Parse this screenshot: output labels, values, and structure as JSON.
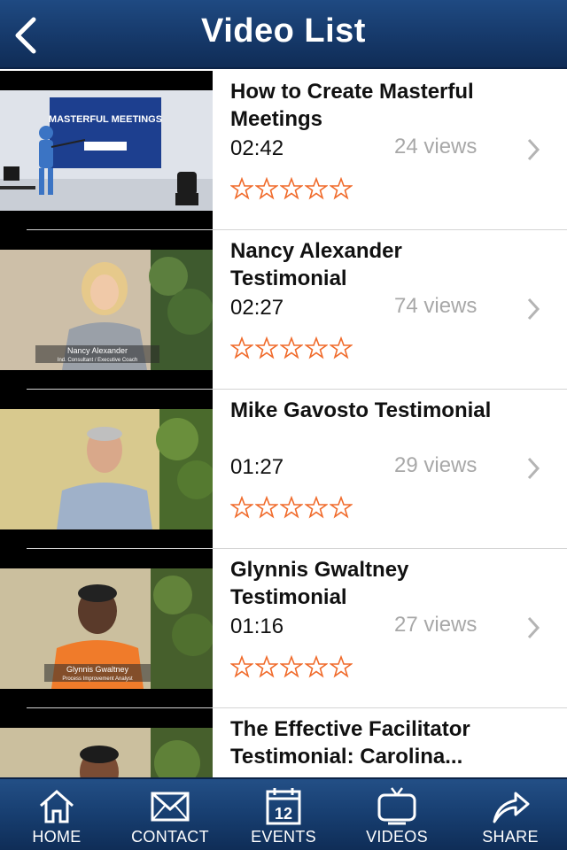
{
  "header": {
    "title": "Video List",
    "back_icon": "chevron-left-icon"
  },
  "videos": [
    {
      "title": "How to Create Masterful Meetings",
      "duration": "02:42",
      "views": "24 views",
      "rating": 0,
      "thumb_caption": "MASTERFUL MEETINGS",
      "thumb_subcaption": ""
    },
    {
      "title": "Nancy Alexander Testimonial",
      "duration": "02:27",
      "views": "74 views",
      "rating": 0,
      "thumb_caption": "Nancy Alexander",
      "thumb_subcaption": "Ind. Consultant / Executive Coach"
    },
    {
      "title": "Mike Gavosto Testimonial",
      "duration": "01:27",
      "views": "29 views",
      "rating": 0,
      "thumb_caption": "",
      "thumb_subcaption": ""
    },
    {
      "title": "Glynnis Gwaltney Testimonial",
      "duration": "01:16",
      "views": "27 views",
      "rating": 0,
      "thumb_caption": "Glynnis Gwaltney",
      "thumb_subcaption": "Process Improvement Analyst"
    },
    {
      "title": "The Effective Facilitator Testimonial: Carolina...",
      "duration": "",
      "views": "",
      "rating": 0,
      "thumb_caption": "",
      "thumb_subcaption": ""
    }
  ],
  "tabs": [
    {
      "label": "HOME",
      "icon": "home-icon"
    },
    {
      "label": "CONTACT",
      "icon": "envelope-icon"
    },
    {
      "label": "EVENTS",
      "icon": "calendar-icon",
      "icon_text": "12"
    },
    {
      "label": "VIDEOS",
      "icon": "tv-icon"
    },
    {
      "label": "SHARE",
      "icon": "share-arrow-icon"
    }
  ],
  "colors": {
    "header": "#16396a",
    "star": "#f06a2a",
    "views": "#a8a8a8"
  }
}
